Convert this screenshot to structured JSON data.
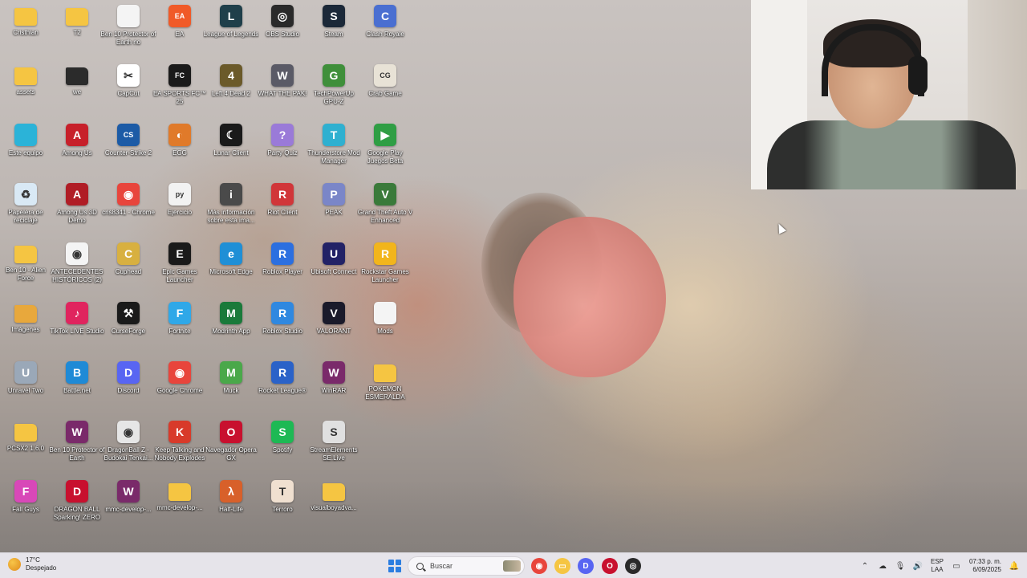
{
  "desktop": {
    "icons": [
      {
        "label": "Cristhian",
        "icon": "folder-icon",
        "color": "#f5c542",
        "glyph": ""
      },
      {
        "label": "T2",
        "icon": "folder-icon",
        "color": "#f5c542",
        "glyph": ""
      },
      {
        "label": "Ben 10 Protector of Earth no",
        "icon": "document-icon",
        "color": "#f4f4f4",
        "glyph": ""
      },
      {
        "label": "EA",
        "icon": "ea-icon",
        "color": "#f05a28",
        "glyph": "EA"
      },
      {
        "label": "League of Legends",
        "icon": "league-of-legends-icon",
        "color": "#1f3f4a",
        "glyph": "L"
      },
      {
        "label": "OBS Studio",
        "icon": "obs-icon",
        "color": "#2a2a2a",
        "glyph": "◎"
      },
      {
        "label": "Steam",
        "icon": "steam-icon",
        "color": "#1b2838",
        "glyph": "S"
      },
      {
        "label": "Clash Royale",
        "icon": "clash-royale-icon",
        "color": "#4a6fd1",
        "glyph": "C"
      },
      {
        "label": "assets",
        "icon": "folder-icon",
        "color": "#f5c542",
        "glyph": ""
      },
      {
        "label": "we",
        "icon": "folder-icon",
        "color": "#2b2b2b",
        "glyph": ""
      },
      {
        "label": "CapCut",
        "icon": "capcut-icon",
        "color": "#ffffff",
        "glyph": "✂"
      },
      {
        "label": "EA SPORTS FC™ 25",
        "icon": "ea-fc-icon",
        "color": "#1a1a1a",
        "glyph": "FC"
      },
      {
        "label": "Left 4 Dead 2",
        "icon": "left4dead-icon",
        "color": "#6b5a2a",
        "glyph": "4"
      },
      {
        "label": "WHAT THE PAK!",
        "icon": "game-icon",
        "color": "#5a5a66",
        "glyph": "W"
      },
      {
        "label": "TechPowerUp GPU-Z",
        "icon": "gpuz-icon",
        "color": "#3f8f3a",
        "glyph": "G"
      },
      {
        "label": "Crab Game",
        "icon": "crab-game-icon",
        "color": "#e8e2d6",
        "glyph": "CG"
      },
      {
        "label": "Este equipo",
        "icon": "computer-icon",
        "color": "#2bb3d8",
        "glyph": ""
      },
      {
        "label": "Among Us",
        "icon": "among-us-icon",
        "color": "#c7202a",
        "glyph": "A"
      },
      {
        "label": "Counter-Strike 2",
        "icon": "counter-strike-icon",
        "color": "#1c5ba6",
        "glyph": "CS"
      },
      {
        "label": "EGG",
        "icon": "egg-icon",
        "color": "#e07a2a",
        "glyph": "◐"
      },
      {
        "label": "Lunar Client",
        "icon": "lunar-client-icon",
        "color": "#1a1a1a",
        "glyph": "☾"
      },
      {
        "label": "Party Quiz",
        "icon": "party-quiz-icon",
        "color": "#9a7ad8",
        "glyph": "?"
      },
      {
        "label": "Thunderstore Mod Manager",
        "icon": "thunderstore-icon",
        "color": "#2fb0d0",
        "glyph": "T"
      },
      {
        "label": "Google Play Juegos Beta",
        "icon": "google-play-games-icon",
        "color": "#2f9e44",
        "glyph": "▶"
      },
      {
        "label": "Papelera de reciclaje",
        "icon": "recycle-bin-icon",
        "color": "#d9e9f5",
        "glyph": "♻"
      },
      {
        "label": "Among Us 3D Demo",
        "icon": "among-us-icon",
        "color": "#b01d25",
        "glyph": "A"
      },
      {
        "label": "cris8341 - Chrome",
        "icon": "chrome-icon",
        "color": "#e8453c",
        "glyph": "◉"
      },
      {
        "label": "Ejercicio",
        "icon": "python-file-icon",
        "color": "#f2f2f2",
        "glyph": "py"
      },
      {
        "label": "Más información sobre esta ima...",
        "icon": "info-icon",
        "color": "#4a4a4a",
        "glyph": "i"
      },
      {
        "label": "Riot Client",
        "icon": "riot-client-icon",
        "color": "#d13639",
        "glyph": "R"
      },
      {
        "label": "PEAK",
        "icon": "peak-icon",
        "color": "#7a86c8",
        "glyph": "P"
      },
      {
        "label": "Grand Theft Auto V Enhanced",
        "icon": "gta-icon",
        "color": "#3a7a3a",
        "glyph": "V"
      },
      {
        "label": "Ben 10 - Alien Force",
        "icon": "folder-icon",
        "color": "#f5c542",
        "glyph": ""
      },
      {
        "label": "ANTECEDENTES HISTÓRICOS (2)",
        "icon": "chrome-doc-icon",
        "color": "#f4f4f4",
        "glyph": "◉"
      },
      {
        "label": "Cuphead",
        "icon": "cuphead-icon",
        "color": "#d8b040",
        "glyph": "C"
      },
      {
        "label": "Epic Games Launcher",
        "icon": "epic-games-icon",
        "color": "#1a1a1a",
        "glyph": "E"
      },
      {
        "label": "Microsoft Edge",
        "icon": "edge-icon",
        "color": "#1f8fd6",
        "glyph": "e"
      },
      {
        "label": "Roblox Player",
        "icon": "roblox-icon",
        "color": "#2b6fe0",
        "glyph": "R"
      },
      {
        "label": "Ubisoft Connect",
        "icon": "ubisoft-icon",
        "color": "#222266",
        "glyph": "U"
      },
      {
        "label": "Rockstar Games Launcher",
        "icon": "rockstar-icon",
        "color": "#f2b51c",
        "glyph": "R"
      },
      {
        "label": "Imágenes",
        "icon": "folder-icon",
        "color": "#e8a83c",
        "glyph": ""
      },
      {
        "label": "TikTok LIVE Studio",
        "icon": "tiktok-icon",
        "color": "#e0245e",
        "glyph": "♪"
      },
      {
        "label": "CurseForge",
        "icon": "curseforge-icon",
        "color": "#1a1a1a",
        "glyph": "⚒"
      },
      {
        "label": "Fortnite",
        "icon": "fortnite-icon",
        "color": "#2fa8e8",
        "glyph": "F"
      },
      {
        "label": "Modrinth App",
        "icon": "modrinth-icon",
        "color": "#1a7a3a",
        "glyph": "M"
      },
      {
        "label": "Roblox Studio",
        "icon": "roblox-studio-icon",
        "color": "#2f88e0",
        "glyph": "R"
      },
      {
        "label": "VALORANT",
        "icon": "valorant-icon",
        "color": "#1a1a2a",
        "glyph": "V"
      },
      {
        "label": "Mods",
        "icon": "document-icon",
        "color": "#f4f4f4",
        "glyph": ""
      },
      {
        "label": "Unravel Two",
        "icon": "unravel-icon",
        "color": "#9aa8b8",
        "glyph": "U"
      },
      {
        "label": "Battle.net",
        "icon": "battlenet-icon",
        "color": "#1f8ad6",
        "glyph": "B"
      },
      {
        "label": "Discord",
        "icon": "discord-icon",
        "color": "#5865f2",
        "glyph": "D"
      },
      {
        "label": "Google Chrome",
        "icon": "chrome-icon",
        "color": "#e8453c",
        "glyph": "◉"
      },
      {
        "label": "Muck",
        "icon": "muck-icon",
        "color": "#4aa84a",
        "glyph": "M"
      },
      {
        "label": "Rocket League®",
        "icon": "rocket-league-icon",
        "color": "#2a62c8",
        "glyph": "R"
      },
      {
        "label": "WinRAR",
        "icon": "winrar-icon",
        "color": "#7a2a6a",
        "glyph": "W"
      },
      {
        "label": "POKEMON ESMERALDA",
        "icon": "folder-icon",
        "color": "#f5c542",
        "glyph": ""
      },
      {
        "label": "PCSX2 1.6.0",
        "icon": "folder-icon",
        "color": "#f5c542",
        "glyph": ""
      },
      {
        "label": "Ben 10 Protector of Earth",
        "icon": "winrar-icon",
        "color": "#7a2a6a",
        "glyph": "W"
      },
      {
        "label": "DragonBall Z - Budokai Tenkai...",
        "icon": "disc-icon",
        "color": "#e6e6e6",
        "glyph": "◉"
      },
      {
        "label": "Keep Talking and Nobody Explodes",
        "icon": "ktane-icon",
        "color": "#d83a2a",
        "glyph": "K"
      },
      {
        "label": "Navegador Opera GX",
        "icon": "opera-gx-icon",
        "color": "#c8102e",
        "glyph": "O"
      },
      {
        "label": "Spotify",
        "icon": "spotify-icon",
        "color": "#1db954",
        "glyph": "S"
      },
      {
        "label": "StreamElements SE.Live",
        "icon": "streamelements-icon",
        "color": "#e0e0e0",
        "glyph": "S"
      },
      {
        "label": "",
        "icon": "blank",
        "color": "transparent",
        "glyph": ""
      },
      {
        "label": "Fall Guys",
        "icon": "fall-guys-icon",
        "color": "#d848b8",
        "glyph": "F"
      },
      {
        "label": "DRAGON BALL Sparking! ZERO",
        "icon": "dragonball-icon",
        "color": "#c8102e",
        "glyph": "D"
      },
      {
        "label": "mmc-develop-...",
        "icon": "winrar-icon",
        "color": "#7a2a6a",
        "glyph": "W"
      },
      {
        "label": "mmc-develop-...",
        "icon": "folder-icon",
        "color": "#f5c542",
        "glyph": ""
      },
      {
        "label": "Half-Life",
        "icon": "half-life-icon",
        "color": "#d8602a",
        "glyph": "λ"
      },
      {
        "label": "Terroro",
        "icon": "terroro-icon",
        "color": "#f0e0d0",
        "glyph": "T"
      },
      {
        "label": "visualboyadva...",
        "icon": "folder-icon",
        "color": "#f5c542",
        "glyph": ""
      },
      {
        "label": "",
        "icon": "blank",
        "color": "transparent",
        "glyph": ""
      }
    ]
  },
  "taskbar": {
    "weather": {
      "temp": "17°C",
      "condition": "Despejado",
      "icon": "moon-weather-icon"
    },
    "search_placeholder": "Buscar",
    "apps": [
      {
        "name": "chrome-taskbar-icon",
        "color": "#e8453c",
        "glyph": "◉"
      },
      {
        "name": "file-explorer-taskbar-icon",
        "color": "#f5c542",
        "glyph": "▭"
      },
      {
        "name": "discord-taskbar-icon",
        "color": "#5865f2",
        "glyph": "D"
      },
      {
        "name": "opera-gx-taskbar-icon",
        "color": "#c8102e",
        "glyph": "O"
      },
      {
        "name": "obs-taskbar-icon",
        "color": "#2a2a2a",
        "glyph": "◎"
      }
    ],
    "lang": {
      "line1": "ESP",
      "line2": "LAA"
    },
    "clock": {
      "time": "07:33 p. m.",
      "date": "6/09/2025"
    }
  }
}
